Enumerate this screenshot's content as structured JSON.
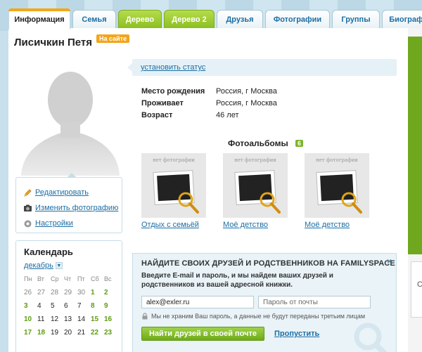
{
  "tabs": [
    {
      "label": "Информация"
    },
    {
      "label": "Семья"
    },
    {
      "label": "Дерево"
    },
    {
      "label": "Дерево 2"
    },
    {
      "label": "Друзья"
    },
    {
      "label": "Фотографии"
    },
    {
      "label": "Группы"
    },
    {
      "label": "Биография"
    }
  ],
  "profile": {
    "name": "Лисичкин Петя",
    "online_badge": "На сайте",
    "set_status": "установить статус"
  },
  "menu": {
    "edit": "Редактировать",
    "change_photo": "Изменить фотографию",
    "settings": "Настройки"
  },
  "info": {
    "birthplace_label": "Место рождения",
    "birthplace_value": "Россия, г Москва",
    "residence_label": "Проживает",
    "residence_value": "Россия, г Москва",
    "age_label": "Возраст",
    "age_value": "46 лет"
  },
  "albums": {
    "title": "Фотоальбомы",
    "count": "6",
    "no_photo": "нет фотографии",
    "items": [
      {
        "name": "Отдых с семьёй"
      },
      {
        "name": "Моё детство"
      },
      {
        "name": "Моё детство"
      }
    ]
  },
  "calendar": {
    "title": "Календарь",
    "month": "декабрь",
    "weekdays": [
      "Пн",
      "Вт",
      "Ср",
      "Чт",
      "Пт",
      "Сб",
      "Вс"
    ],
    "rows": [
      [
        "26",
        "27",
        "28",
        "29",
        "30",
        "1",
        "2"
      ],
      [
        "3",
        "4",
        "5",
        "6",
        "7",
        "8",
        "9"
      ],
      [
        "10",
        "11",
        "12",
        "13",
        "14",
        "15",
        "16"
      ],
      [
        "17",
        "18",
        "19",
        "20",
        "21",
        "22",
        "23"
      ]
    ]
  },
  "find_friends": {
    "title": "НАЙДИТЕ СВОИХ ДРУЗЕЙ И РОДСТВЕННИКОВ НА FAMILYSPACE",
    "description": "Введите E-mail и пароль, и мы найдем ваших друзей и родственников из вашей адресной книжки.",
    "email_value": "alex@exler.ru",
    "password_placeholder": "Пароль от почты",
    "privacy_note": "Мы не храним Ваш пароль, а данные не будут переданы третьим лицам",
    "find_button": "Найти друзей в своей почте",
    "skip_link": "Пропустить",
    "close": "×"
  },
  "right_box_text": "С",
  "colors": {
    "link": "#1c6ea4",
    "tab_green": "#8cbf22",
    "badge_orange": "#f3a51a",
    "info_bg": "#e5f1f7"
  }
}
